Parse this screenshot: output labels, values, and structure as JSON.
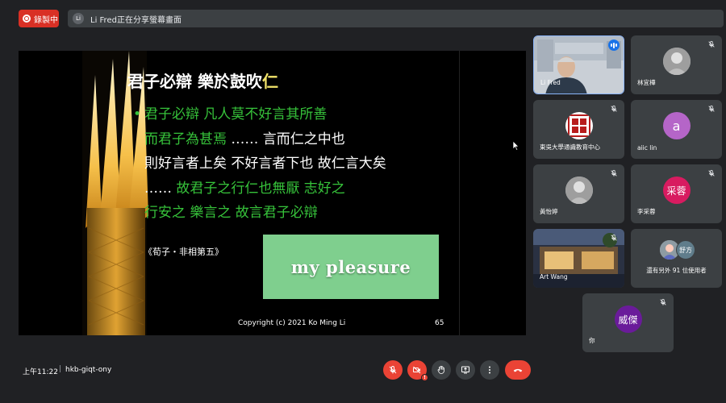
{
  "recording": {
    "label": "錄製中"
  },
  "share_banner": {
    "avatar_letter": "Li",
    "text": "Li Fred正在分享螢幕畫面"
  },
  "slide": {
    "title_main": "君子必辯  樂於鼓吹",
    "title_highlight": "仁",
    "lines": [
      [
        {
          "t": "君子必辯  凡人莫不好言其所善",
          "c": "g"
        }
      ],
      [
        {
          "t": "而君子為甚焉",
          "c": "g"
        },
        {
          "t": "  ……  言而仁之中也",
          "c": "w"
        }
      ],
      [
        {
          "t": "則好言者上矣  不好言者下也  故仁言大矣",
          "c": "w"
        }
      ],
      [
        {
          "t": "……",
          "c": "w"
        },
        {
          "t": "  故君子之行仁也無厭  志好之",
          "c": "g"
        }
      ],
      [
        {
          "t": "行安之  樂言之  故言君子必辯",
          "c": "g"
        }
      ]
    ],
    "citation": "《荀子・非相第五》",
    "image_text": "my pleasure",
    "copyright": "Copyright (c) 2021 Ko Ming Li",
    "page_number": "65"
  },
  "participants": [
    {
      "name": "Li Fred",
      "kind": "video",
      "speaking": true
    },
    {
      "name": "林宜樺",
      "kind": "photo",
      "muted": true
    },
    {
      "name": "東吳大學通識教育中心",
      "kind": "logo",
      "muted": true
    },
    {
      "name": "aiic lin",
      "kind": "letter",
      "letter": "a",
      "color": "#b565c8",
      "muted": true
    },
    {
      "name": "黃怡婷",
      "kind": "photo",
      "muted": true
    },
    {
      "name": "李采蓉",
      "kind": "letter",
      "letter": "采蓉",
      "color": "#d81b60",
      "muted": true
    },
    {
      "name": "Art Wang",
      "kind": "video",
      "muted": true
    },
    {
      "name": "還有另外 91 位使用者",
      "kind": "more",
      "extra_label": "舒方"
    },
    {
      "name": "你",
      "kind": "letter",
      "letter": "威傑",
      "color": "#6a1b9a",
      "muted": true
    }
  ],
  "meeting": {
    "time": "上午11:22",
    "separator": "|",
    "code": "hkb-giqt-ony"
  },
  "controls": [
    {
      "name": "mic-toggle-button",
      "icon": "mic-off-icon"
    },
    {
      "name": "camera-toggle-button",
      "icon": "camera-off-icon"
    },
    {
      "name": "raise-hand-button",
      "icon": "hand-icon"
    },
    {
      "name": "present-screen-button",
      "icon": "present-icon"
    },
    {
      "name": "more-options-button",
      "icon": "more-vert-icon"
    },
    {
      "name": "leave-call-button",
      "icon": "call-end-icon"
    }
  ],
  "colors": {
    "background": "#202124",
    "tile": "#3c4043",
    "recording": "#d93025",
    "slide_green": "#36c23a",
    "slide_title_highlight": "#f2e36a",
    "end_call": "#ea4335"
  }
}
